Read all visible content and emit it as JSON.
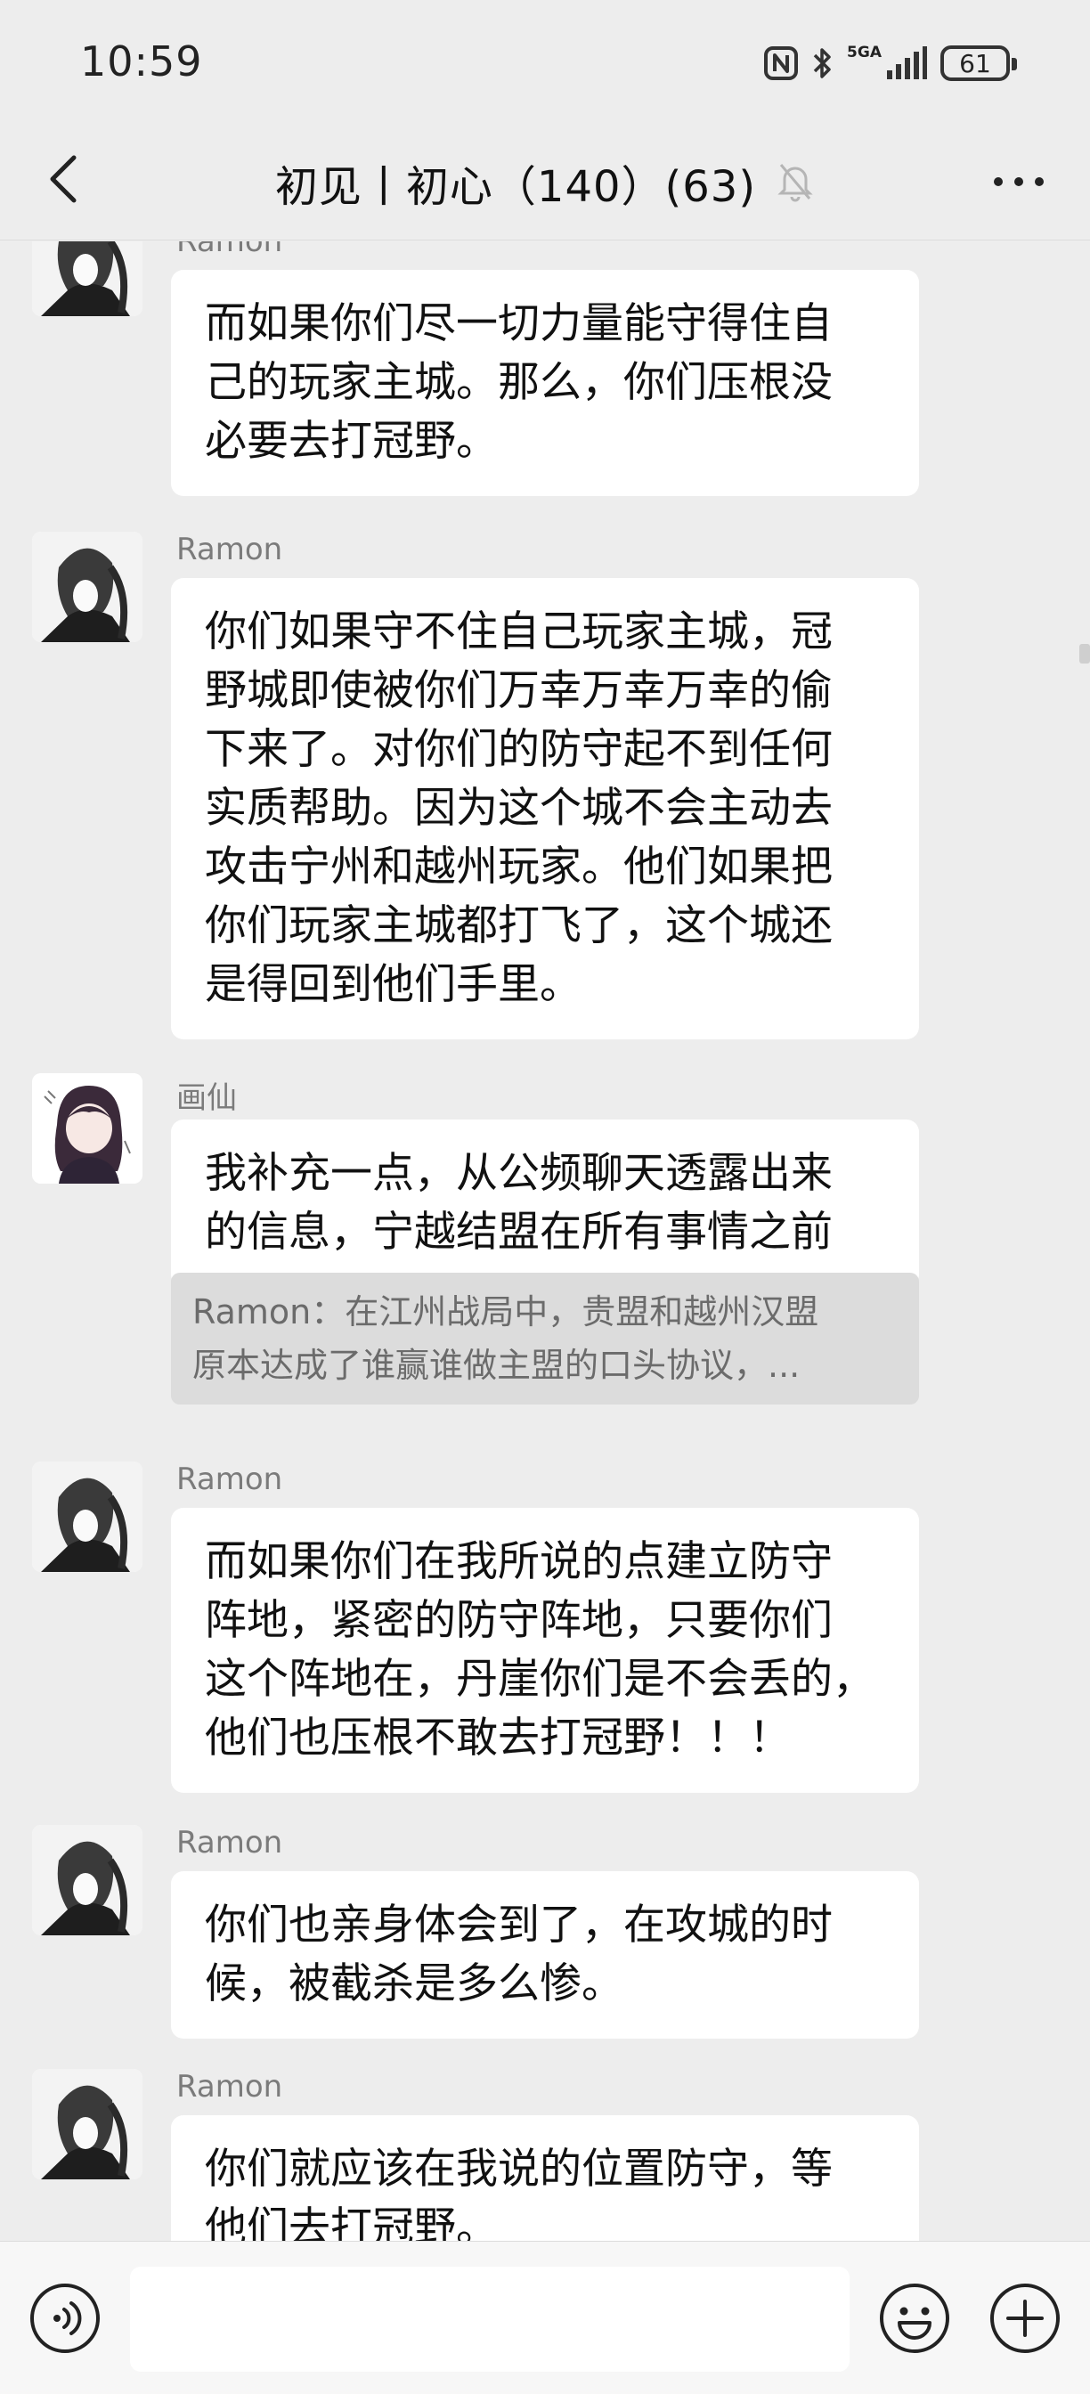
{
  "status_bar": {
    "time": "10:59",
    "network_label": "5GA",
    "battery": "61",
    "icons": [
      "nfc-icon",
      "bluetooth-icon",
      "signal-icon",
      "battery-icon"
    ]
  },
  "nav": {
    "title": "初见丨初心（140）(63)",
    "icons": [
      "back-icon",
      "mute-bell-icon",
      "more-icon"
    ]
  },
  "messages": [
    {
      "sender": "Ramon",
      "avatar": "ponytail-avatar",
      "lines": [
        "而如果你们尽一切力量能守得住自",
        "己的玩家主城。那么，你们压根没",
        "必要去打冠野。"
      ]
    },
    {
      "sender": "Ramon",
      "avatar": "ponytail-avatar",
      "lines": [
        "你们如果守不住自己玩家主城，冠",
        "野城即使被你们万幸万幸万幸的偷",
        "下来了。对你们的防守起不到任何",
        "实质帮助。因为这个城不会主动去",
        "攻击宁州和越州玩家。他们如果把",
        "你们玩家主城都打飞了，这个城还",
        "是得回到他们手里。"
      ]
    },
    {
      "sender": "画仙",
      "avatar": "anime-girl-avatar",
      "lines": [
        "我补充一点，从公频聊天透露出来",
        "的信息，宁越结盟在所有事情之前"
      ],
      "quote_lines": [
        "Ramon：在江州战局中，贵盟和越州汉盟",
        "原本达成了谁赢谁做主盟的口头协议，..."
      ]
    },
    {
      "sender": "Ramon",
      "avatar": "ponytail-avatar",
      "lines": [
        "而如果你们在我所说的点建立防守",
        "阵地，紧密的防守阵地，只要你们",
        "这个阵地在，丹崖你们是不会丢的，",
        "他们也压根不敢去打冠野！！！"
      ]
    },
    {
      "sender": "Ramon",
      "avatar": "ponytail-avatar",
      "lines": [
        "你们也亲身体会到了，在攻城的时",
        "候，被截杀是多么惨。"
      ]
    },
    {
      "sender": "Ramon",
      "avatar": "ponytail-avatar",
      "lines": [
        "你们就应该在我说的位置防守，等",
        "他们去打冠野。"
      ]
    }
  ],
  "input_bar": {
    "text_value": "",
    "icons": [
      "voice-icon",
      "emoji-icon",
      "plus-icon"
    ]
  }
}
